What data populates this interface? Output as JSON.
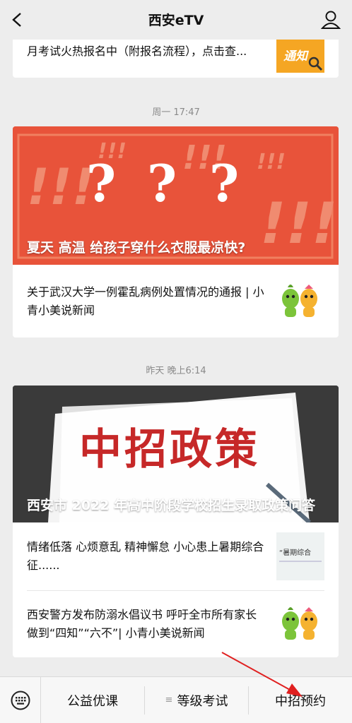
{
  "header": {
    "title": "西安eTV"
  },
  "feed": {
    "top_card": {
      "title": "月考试火热报名中（附报名流程），点击查...",
      "thumb_text": "通知"
    },
    "group1": {
      "time": "周一 17:47",
      "hero_caption": "夏天 高温 给孩子穿什么衣服最凉快?",
      "hero_marks": [
        "?",
        "?",
        "?"
      ],
      "item": {
        "title": "关于武汉大学一例霍乱病例处置情况的通报 | 小青小美说新闻"
      }
    },
    "group2": {
      "time": "昨天 晚上6:14",
      "hero_banner": "中招政策",
      "hero_caption": "西安市 2022 年高中阶段学校招生录取政策问答",
      "items": [
        {
          "title": "情绪低落 心烦意乱 精神懈怠 小心患上暑期综合征......",
          "thumb_text": "“暑期综合"
        },
        {
          "title": "西安警方发布防溺水倡议书 呼吁全市所有家长做到“四知”“六不”| 小青小美说新闻"
        }
      ]
    }
  },
  "menu": {
    "items": [
      {
        "label": "公益优课"
      },
      {
        "label": "等级考试",
        "prefix": "≡"
      },
      {
        "label": "中招预约"
      }
    ]
  },
  "colors": {
    "hero_red": "#e8533a",
    "annotation_arrow": "#e02020",
    "notice_orange": "#f5a623"
  }
}
